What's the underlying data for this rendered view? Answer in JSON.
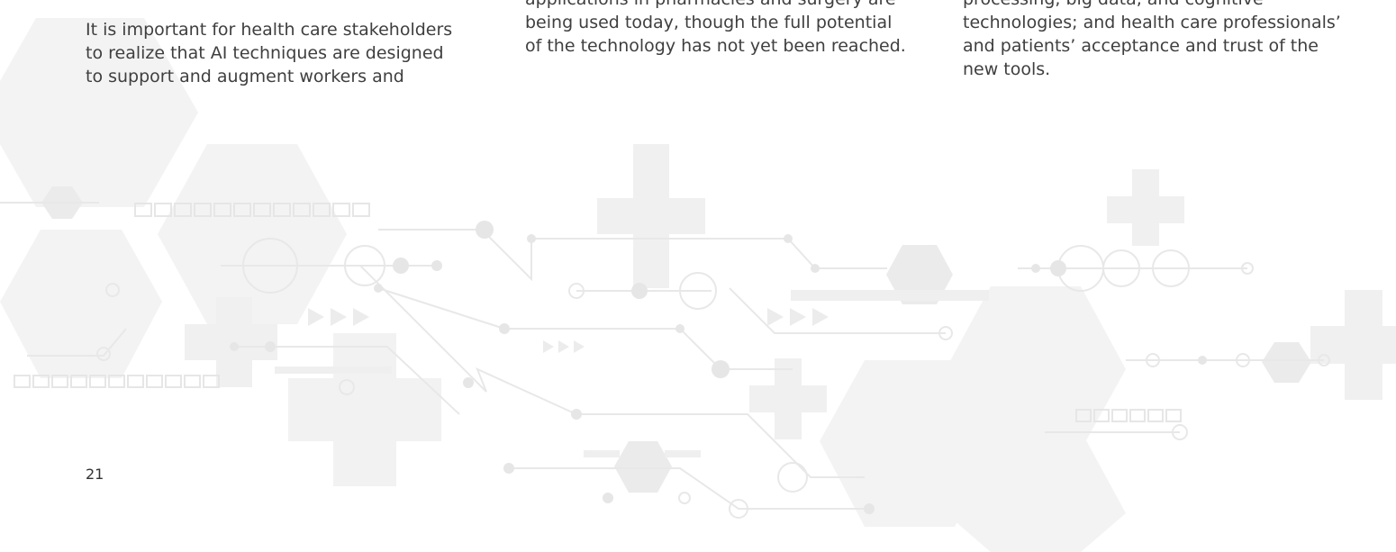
{
  "columns": [
    {
      "lines": [
        "It is important for health care stakeholders",
        "to realize that AI techniques are designed",
        "to support and augment workers and"
      ]
    },
    {
      "lines": [
        "applications in pharmacies and surgery are",
        "being used today, though the full potential",
        "of the technology has not yet been reached."
      ]
    },
    {
      "lines": [
        "processing, big data, and cognitive",
        "technologies; and health care professionals’",
        "and patients’ acceptance and trust of the",
        "new tools."
      ]
    }
  ],
  "page_number": "21",
  "colors": {
    "text": "#3f3f3f",
    "decoration": "#f2f2f2",
    "decoration_line": "#e6e6e6"
  },
  "icons": [
    "hexagon-icon",
    "medical-cross-icon",
    "circuit-node-icon",
    "arrow-triangle-icon"
  ]
}
